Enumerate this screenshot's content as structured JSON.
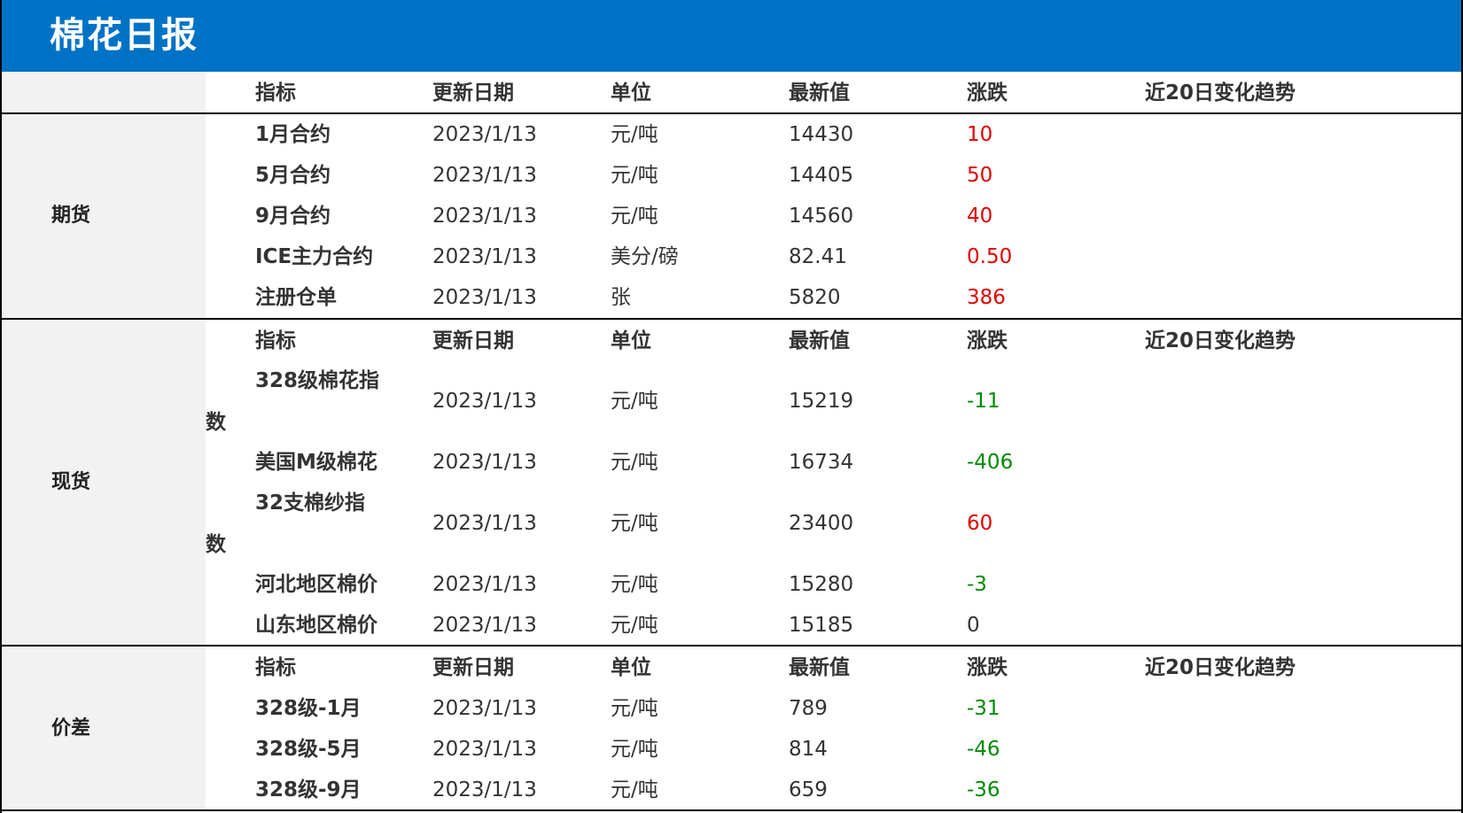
{
  "title": "棉花日报",
  "headers": {
    "indicator": "指标",
    "date": "更新日期",
    "unit": "单位",
    "latest": "最新值",
    "change": "涨跌",
    "trend": "近20日变化趋势"
  },
  "sections": [
    {
      "category": "期货",
      "rows": [
        {
          "name": "1月合约",
          "date": "2023/1/13",
          "unit": "元/吨",
          "value": "14430",
          "change": "10",
          "dir": "up"
        },
        {
          "name": "5月合约",
          "date": "2023/1/13",
          "unit": "元/吨",
          "value": "14405",
          "change": "50",
          "dir": "up"
        },
        {
          "name": "9月合约",
          "date": "2023/1/13",
          "unit": "元/吨",
          "value": "14560",
          "change": "40",
          "dir": "up"
        },
        {
          "name": "ICE主力合约",
          "date": "2023/1/13",
          "unit": "美分/磅",
          "value": "82.41",
          "change": "0.50",
          "dir": "up"
        },
        {
          "name": "注册仓单",
          "date": "2023/1/13",
          "unit": "张",
          "value": "5820",
          "change": "386",
          "dir": "up"
        }
      ]
    },
    {
      "category": "现货",
      "rows": [
        {
          "name": "328级棉花指",
          "name_wrap": "数",
          "date": "2023/1/13",
          "unit": "元/吨",
          "value": "15219",
          "change": "-11",
          "dir": "down"
        },
        {
          "name": "美国M级棉花",
          "date": "2023/1/13",
          "unit": "元/吨",
          "value": "16734",
          "change": "-406",
          "dir": "down"
        },
        {
          "name": "32支棉纱指",
          "name_wrap": "数",
          "date": "2023/1/13",
          "unit": "元/吨",
          "value": "23400",
          "change": "60",
          "dir": "up"
        },
        {
          "name": "河北地区棉价",
          "date": "2023/1/13",
          "unit": "元/吨",
          "value": "15280",
          "change": "-3",
          "dir": "down"
        },
        {
          "name": "山东地区棉价",
          "date": "2023/1/13",
          "unit": "元/吨",
          "value": "15185",
          "change": "0",
          "dir": "flat"
        }
      ]
    },
    {
      "category": "价差",
      "rows": [
        {
          "name": "328级-1月",
          "date": "2023/1/13",
          "unit": "元/吨",
          "value": "789",
          "change": "-31",
          "dir": "down"
        },
        {
          "name": "328级-5月",
          "date": "2023/1/13",
          "unit": "元/吨",
          "value": "814",
          "change": "-46",
          "dir": "down"
        },
        {
          "name": "328级-9月",
          "date": "2023/1/13",
          "unit": "元/吨",
          "value": "659",
          "change": "-36",
          "dir": "down"
        }
      ]
    }
  ],
  "colors": {
    "header_bg": "#0072c6",
    "up": "#e00000",
    "down": "#008a00",
    "category_bg": "#f2f2f2"
  }
}
